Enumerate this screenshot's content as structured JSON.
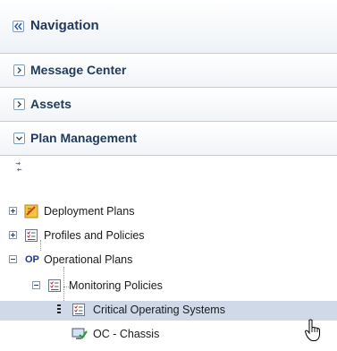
{
  "header": {
    "title": "Navigation",
    "collapse_icon": "double-chevron-left-icon"
  },
  "sections": [
    {
      "label": "Message Center",
      "state": "collapsed"
    },
    {
      "label": "Assets",
      "state": "collapsed"
    },
    {
      "label": "Plan Management",
      "state": "expanded"
    }
  ],
  "toolbar": {
    "refresh_icon": "refresh-icon"
  },
  "tree": {
    "items": [
      {
        "label": "Deployment Plans",
        "icon": "deployment-plan-icon",
        "expander": "plus"
      },
      {
        "label": "Profiles and Policies",
        "icon": "checklist-icon",
        "expander": "plus"
      },
      {
        "label": "Operational Plans",
        "icon": "op-icon",
        "expander": "minus"
      },
      {
        "label": "Monitoring Policies",
        "icon": "checklist-icon",
        "expander": "minus"
      },
      {
        "label": "Critical Operating Systems",
        "icon": "checklist-icon",
        "selected": true
      },
      {
        "label": "OC - Chassis",
        "icon": "monitor-check-icon"
      }
    ]
  },
  "colors": {
    "title": "#1f3a5a",
    "selection": "#cfd9e7",
    "border": "#c3cdd8"
  }
}
